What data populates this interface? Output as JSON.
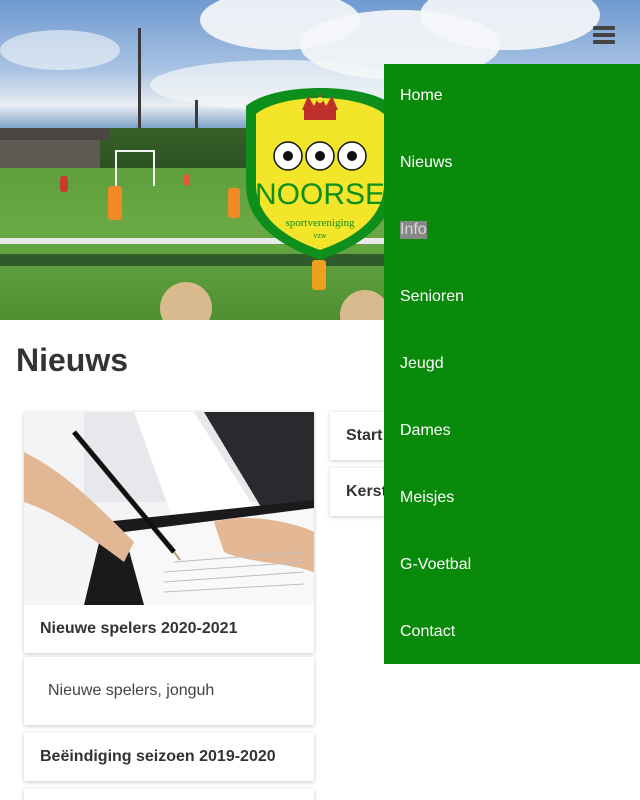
{
  "site": {
    "logo_text": "NOORSE",
    "logo_subtext": "sportvereniging",
    "logo_subtext2": "vzw"
  },
  "nav": {
    "items": [
      {
        "label": "Home"
      },
      {
        "label": "Nieuws"
      },
      {
        "label": "Info",
        "active": true
      },
      {
        "label": "Senioren"
      },
      {
        "label": "Jeugd"
      },
      {
        "label": "Dames"
      },
      {
        "label": "Meisjes"
      },
      {
        "label": "G-Voetbal"
      },
      {
        "label": "Contact"
      }
    ]
  },
  "main": {
    "title": "Nieuws",
    "cards": [
      {
        "title": "Nieuwe spelers 2020-2021",
        "excerpt": "Nieuwe spelers, jonguh"
      },
      {
        "title": "Beëindiging seizoen 2019-2020"
      },
      {
        "title": "Start"
      },
      {
        "title": "Kerst"
      }
    ]
  },
  "colors": {
    "nav_bg": "#0a8a0a",
    "logo_green": "#0e8f1c",
    "logo_yellow": "#f3e52a"
  }
}
